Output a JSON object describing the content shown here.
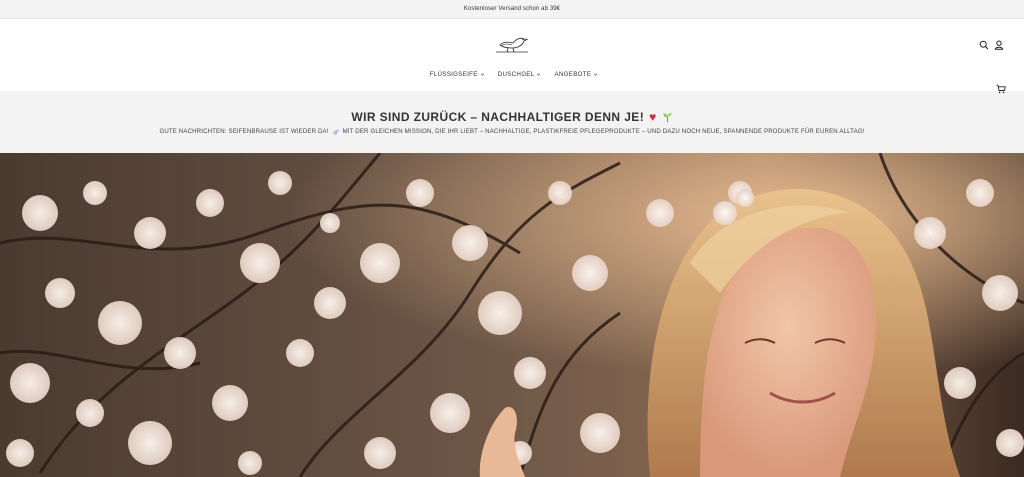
{
  "announcement": {
    "text": "Kostenloser Versand schon ab 39€"
  },
  "header": {
    "logo_name": "bird-logo",
    "icons": [
      "search-icon",
      "user-icon",
      "cart-icon"
    ]
  },
  "nav": {
    "items": [
      {
        "label": "FLÜSSIGSEIFE"
      },
      {
        "label": "DUSCHGEL"
      },
      {
        "label": "ANGEBOTE"
      }
    ]
  },
  "banner": {
    "title": "WIR SIND ZURÜCK – NACHHALTIGER DENN JE!",
    "title_emojis": [
      "heart",
      "seedling"
    ],
    "subtitle_part1": "GUTE NACHRICHTEN: SEIFENBRAUSE IST WIEDER DA!",
    "subtitle_part2": "MIT DER GLEICHEN MISSION, DIE IHR LIEBT – NACHHALTIGE, PLASTIKFREIE PFLEGEPRODUKTE – UND DAZU NOCH NEUE, SPANNENDE PRODUKTE FÜR EUREN ALLTAG!",
    "subtitle_emoji": "bubbles"
  },
  "hero": {
    "image_name": "woman-with-cherry-blossoms-photo"
  },
  "colors": {
    "announcement_bg": "#f4f4f4",
    "banner_bg": "#f3f3f3",
    "heart": "#e0243a",
    "text": "#333333"
  }
}
